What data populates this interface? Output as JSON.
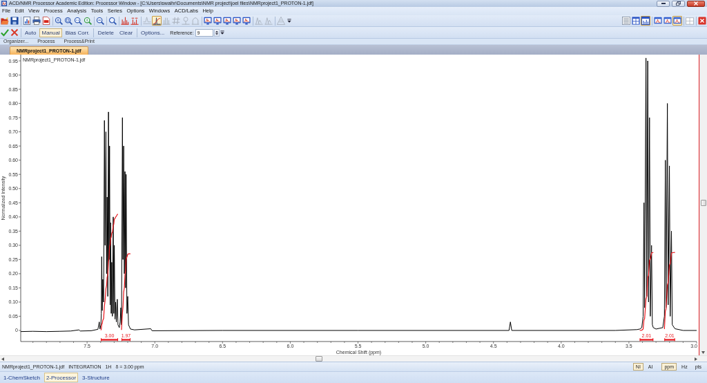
{
  "window": {
    "title": "ACD/NMR Processor Academic Edition: Processor Window - [C:\\Users\\swaihr\\Documents\\NMR project\\joel files\\NMRproject1_PROTON-1.jdf]"
  },
  "menu": [
    "File",
    "Edit",
    "View",
    "Process",
    "Analysis",
    "Tools",
    "Series",
    "Options",
    "Windows",
    "ACD/Labs",
    "Help"
  ],
  "toolbar": {
    "left_groups": [
      [
        {
          "kind": "open",
          "disabled": false,
          "selected": false
        },
        {
          "kind": "save",
          "disabled": false,
          "selected": false
        }
      ],
      [
        {
          "kind": "report",
          "disabled": false,
          "selected": false
        },
        {
          "kind": "print",
          "disabled": false,
          "selected": false
        },
        {
          "kind": "pdf",
          "disabled": false,
          "selected": false
        }
      ],
      [
        {
          "kind": "zoomfit",
          "disabled": false,
          "selected": false
        },
        {
          "kind": "zoombox",
          "disabled": false,
          "selected": false
        },
        {
          "kind": "zoomx",
          "disabled": false,
          "selected": false
        },
        {
          "kind": "zoomy",
          "disabled": false,
          "selected": false
        }
      ],
      [
        {
          "kind": "zoomout",
          "disabled": false,
          "selected": false
        }
      ],
      [
        {
          "kind": "zoomall",
          "disabled": false,
          "selected": false
        }
      ],
      [
        {
          "kind": "peaks",
          "disabled": false,
          "selected": false
        },
        {
          "kind": "peaklabels",
          "disabled": false,
          "selected": false
        }
      ],
      [
        {
          "kind": "baseline",
          "disabled": true,
          "selected": false
        },
        {
          "kind": "integrate",
          "disabled": false,
          "selected": true
        },
        {
          "kind": "multiplet",
          "disabled": true,
          "selected": false
        },
        {
          "kind": "hash",
          "disabled": true,
          "selected": false
        },
        {
          "kind": "assign",
          "disabled": true,
          "selected": false
        },
        {
          "kind": "couple",
          "disabled": true,
          "selected": false
        }
      ],
      [
        {
          "kind": "spectrum",
          "disabled": false,
          "selected": false
        },
        {
          "kind": "spectrum",
          "disabled": false,
          "selected": false
        },
        {
          "kind": "spectrum",
          "disabled": false,
          "selected": false
        },
        {
          "kind": "spectrum",
          "disabled": false,
          "selected": false
        },
        {
          "kind": "spectrum",
          "disabled": false,
          "selected": false
        }
      ],
      [
        {
          "kind": "overlay",
          "disabled": true,
          "selected": false
        },
        {
          "kind": "overlay",
          "disabled": true,
          "selected": false
        }
      ],
      [
        {
          "kind": "stack",
          "disabled": true,
          "selected": false
        },
        {
          "kind": "more",
          "disabled": false,
          "selected": false
        }
      ]
    ],
    "right_groups": [
      [
        {
          "kind": "list",
          "disabled": false,
          "selected": false
        },
        {
          "kind": "tile",
          "disabled": false,
          "selected": false
        },
        {
          "kind": "window",
          "disabled": false,
          "selected": true
        }
      ],
      [
        {
          "kind": "layout",
          "disabled": false,
          "selected": false
        },
        {
          "kind": "layout",
          "disabled": false,
          "selected": false
        },
        {
          "kind": "layout",
          "disabled": false,
          "selected": true
        }
      ],
      [
        {
          "kind": "grid",
          "disabled": true,
          "selected": false
        }
      ],
      [
        {
          "kind": "close",
          "disabled": false,
          "selected": false
        }
      ]
    ]
  },
  "processing_bar": {
    "actions": [
      {
        "kind": "accept"
      },
      {
        "kind": "reject"
      }
    ],
    "modes": [
      {
        "label": "Auto",
        "selected": false
      },
      {
        "label": "Manual",
        "selected": true
      },
      {
        "label": "Bias Corr.",
        "selected": false
      }
    ],
    "edits": [
      "Delete",
      "Clear"
    ],
    "options": "Options...",
    "reference": {
      "label": "Reference:",
      "value": "9"
    }
  },
  "ribbon_groups": [
    "Organizer...",
    "Process",
    "Process&Print"
  ],
  "document_tabs": [
    {
      "label": "NMRproject1_PROTON-1.jdf",
      "selected": true
    }
  ],
  "spectrum": {
    "chart_data": {
      "type": "line",
      "title": "NMRproject1_PROTON-1.jdf",
      "xlabel": "Chemical Shift (ppm)",
      "ylabel": "Normalized Intensity",
      "x": [
        7.99,
        7.9,
        7.8,
        7.7,
        7.62,
        7.56,
        7.55,
        7.47,
        7.42,
        7.41,
        7.405,
        7.398,
        7.395,
        7.392,
        7.388,
        7.384,
        7.378,
        7.372,
        7.367,
        7.361,
        7.356,
        7.352,
        7.347,
        7.342,
        7.338,
        7.334,
        7.33,
        7.326,
        7.322,
        7.318,
        7.313,
        7.307,
        7.303,
        7.299,
        7.294,
        7.289,
        7.284,
        7.277,
        7.272,
        7.262,
        7.256,
        7.251,
        7.246,
        7.239,
        7.235,
        7.23,
        7.225,
        7.22,
        7.216,
        7.212,
        7.206,
        7.2,
        7.194,
        7.18,
        7.15,
        7.03,
        7.02,
        6.5,
        5.5,
        4.385,
        4.375,
        4.365,
        3.6,
        3.44,
        3.42,
        3.405,
        3.395,
        3.389,
        3.384,
        3.374,
        3.368,
        3.361,
        3.355,
        3.348,
        3.342,
        3.333,
        3.327,
        3.32,
        3.3,
        3.25,
        3.238,
        3.231,
        3.226,
        3.216,
        3.21,
        3.201,
        3.195,
        3.186,
        3.18,
        3.16,
        3.1,
        3.0
      ],
      "series": [
        {
          "color": "#000000",
          "values": [
            -0.004,
            -0.003,
            -0.004,
            -0.003,
            -0.002,
            0.002,
            -0.002,
            -0.001,
            0.004,
            0.03,
            0.005,
            0.02,
            0.06,
            0.26,
            0.07,
            0.18,
            0.1,
            0.74,
            0.3,
            0.7,
            0.2,
            0.47,
            0.12,
            0.77,
            0.25,
            0.65,
            0.09,
            0.38,
            0.06,
            0.24,
            0.05,
            0.4,
            0.06,
            0.3,
            0.04,
            0.1,
            0.03,
            0.11,
            0.02,
            0.01,
            0.03,
            0.08,
            0.02,
            0.75,
            0.25,
            0.65,
            0.2,
            0.56,
            0.15,
            0.55,
            0.06,
            0.12,
            0.02,
            0.005,
            0.002,
            0.006,
            -0.001,
            0,
            0,
            0,
            0.03,
            0,
            0,
            0.003,
            0.005,
            0.01,
            0.05,
            0.45,
            0.08,
            0.96,
            0.12,
            0.95,
            0.1,
            0.75,
            0.05,
            0.3,
            0.02,
            0.01,
            0.005,
            0.01,
            0.05,
            0.6,
            0.08,
            0.8,
            0.09,
            0.58,
            0.05,
            0.35,
            0.02,
            0.006,
            0,
            0
          ]
        },
        {
          "color": "#e8151b",
          "values": [
            null,
            null,
            null,
            null,
            null,
            null,
            null,
            null,
            null,
            null,
            null,
            0.001,
            0.005,
            0.021,
            0.025,
            0.036,
            0.042,
            0.087,
            0.105,
            0.147,
            0.159,
            0.188,
            0.195,
            0.242,
            0.257,
            0.296,
            0.302,
            0.325,
            0.328,
            0.343,
            0.346,
            0.37,
            0.374,
            0.392,
            0.394,
            0.4,
            0.402,
            0.409,
            0.41,
            null,
            null,
            null,
            0.002,
            0.062,
            0.083,
            0.135,
            0.151,
            0.197,
            0.209,
            0.253,
            0.258,
            0.268,
            0.27,
            0.27,
            null,
            null,
            null,
            null,
            null,
            null,
            null,
            null,
            null,
            null,
            0,
            0.001,
            0.005,
            0.037,
            0.042,
            0.111,
            0.119,
            0.187,
            0.194,
            0.248,
            0.251,
            0.273,
            0.274,
            0.275,
            null,
            null,
            0.005,
            0.068,
            0.076,
            0.16,
            0.17,
            0.23,
            0.236,
            0.272,
            0.274,
            0.275,
            null,
            null
          ]
        }
      ],
      "xlim": [
        7.99,
        3.0
      ],
      "ylim": [
        -0.039,
        0.972
      ],
      "xticks": [
        {
          "value": 7.5,
          "label": "7.5"
        },
        {
          "value": 7.0,
          "label": "7.0"
        },
        {
          "value": 6.5,
          "label": "6.5"
        },
        {
          "value": 6.0,
          "label": "6.0"
        },
        {
          "value": 5.5,
          "label": "5.5"
        },
        {
          "value": 5.0,
          "label": "5.0"
        },
        {
          "value": 4.5,
          "label": "4.5"
        },
        {
          "value": 4.0,
          "label": "4.0"
        },
        {
          "value": 3.5,
          "label": "3.5"
        },
        {
          "value": 3.0,
          "label": "3.0"
        }
      ],
      "yticks": [
        {
          "value": 0,
          "label": "0"
        },
        {
          "value": 0.05,
          "label": "0.05"
        },
        {
          "value": 0.1,
          "label": "0.10"
        },
        {
          "value": 0.15,
          "label": "0.15"
        },
        {
          "value": 0.2,
          "label": "0.20"
        },
        {
          "value": 0.25,
          "label": "0.25"
        },
        {
          "value": 0.3,
          "label": "0.30"
        },
        {
          "value": 0.35,
          "label": "0.35"
        },
        {
          "value": 0.4,
          "label": "0.40"
        },
        {
          "value": 0.45,
          "label": "0.45"
        },
        {
          "value": 0.5,
          "label": "0.50"
        },
        {
          "value": 0.55,
          "label": "0.55"
        },
        {
          "value": 0.6,
          "label": "0.60"
        },
        {
          "value": 0.65,
          "label": "0.65"
        },
        {
          "value": 0.7,
          "label": "0.70"
        },
        {
          "value": 0.75,
          "label": "0.75"
        },
        {
          "value": 0.8,
          "label": "0.80"
        },
        {
          "value": 0.85,
          "label": "0.85"
        },
        {
          "value": 0.9,
          "label": "0.90"
        },
        {
          "value": 0.95,
          "label": "0.95"
        }
      ],
      "annotations": [
        "3.00",
        "1.97",
        "2.01",
        "2.01"
      ]
    }
  },
  "status_bar": {
    "items": [
      "NMRproject1_PROTON-1.jdf",
      "INTEGRATION",
      "1H",
      "δ = 3.00 ppm"
    ],
    "intensity": [
      {
        "label": "NI",
        "selected": true
      },
      {
        "label": "AI",
        "selected": false
      }
    ],
    "units": [
      {
        "label": "ppm",
        "selected": true
      },
      {
        "label": "Hz",
        "selected": false
      },
      {
        "label": "pts",
        "selected": false
      }
    ]
  },
  "bottom_tabs": [
    {
      "label": "1-ChemSketch",
      "selected": false
    },
    {
      "label": "2-Processor",
      "selected": true
    },
    {
      "label": "3-Structure",
      "selected": false
    }
  ]
}
